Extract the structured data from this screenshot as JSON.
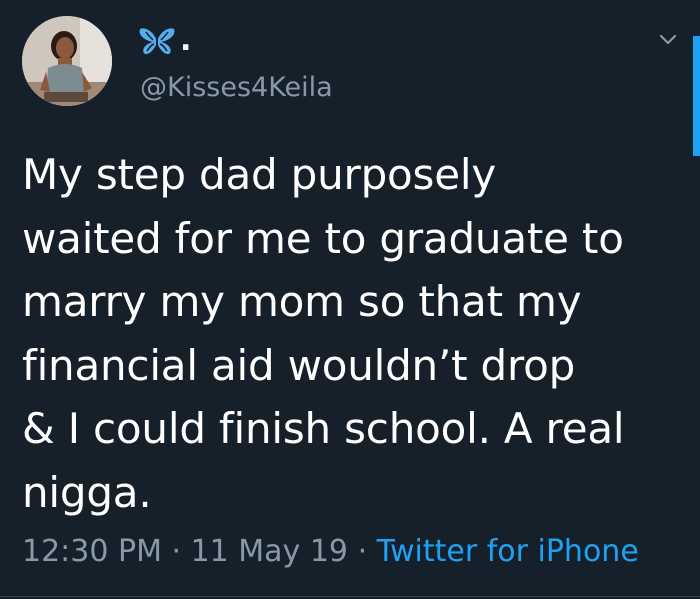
{
  "tweet": {
    "display_name_suffix": ".",
    "handle": "@Kisses4Keila",
    "text_lines": [
      "My step dad purposely",
      "waited for me to graduate to",
      "marry my mom so that my",
      "financial aid wouldn’t drop",
      "& I could finish school. A real",
      "nigga."
    ],
    "time": "12:30 PM",
    "separator1": " · ",
    "date": "11 May 19",
    "separator2": " · ",
    "source": "Twitter for iPhone"
  },
  "icons": {
    "name_emoji": "butterfly-icon",
    "menu": "chevron-down-icon"
  },
  "colors": {
    "background": "#15202b",
    "text": "#ffffff",
    "secondary_text": "#8899a6",
    "accent": "#1da1f2"
  }
}
